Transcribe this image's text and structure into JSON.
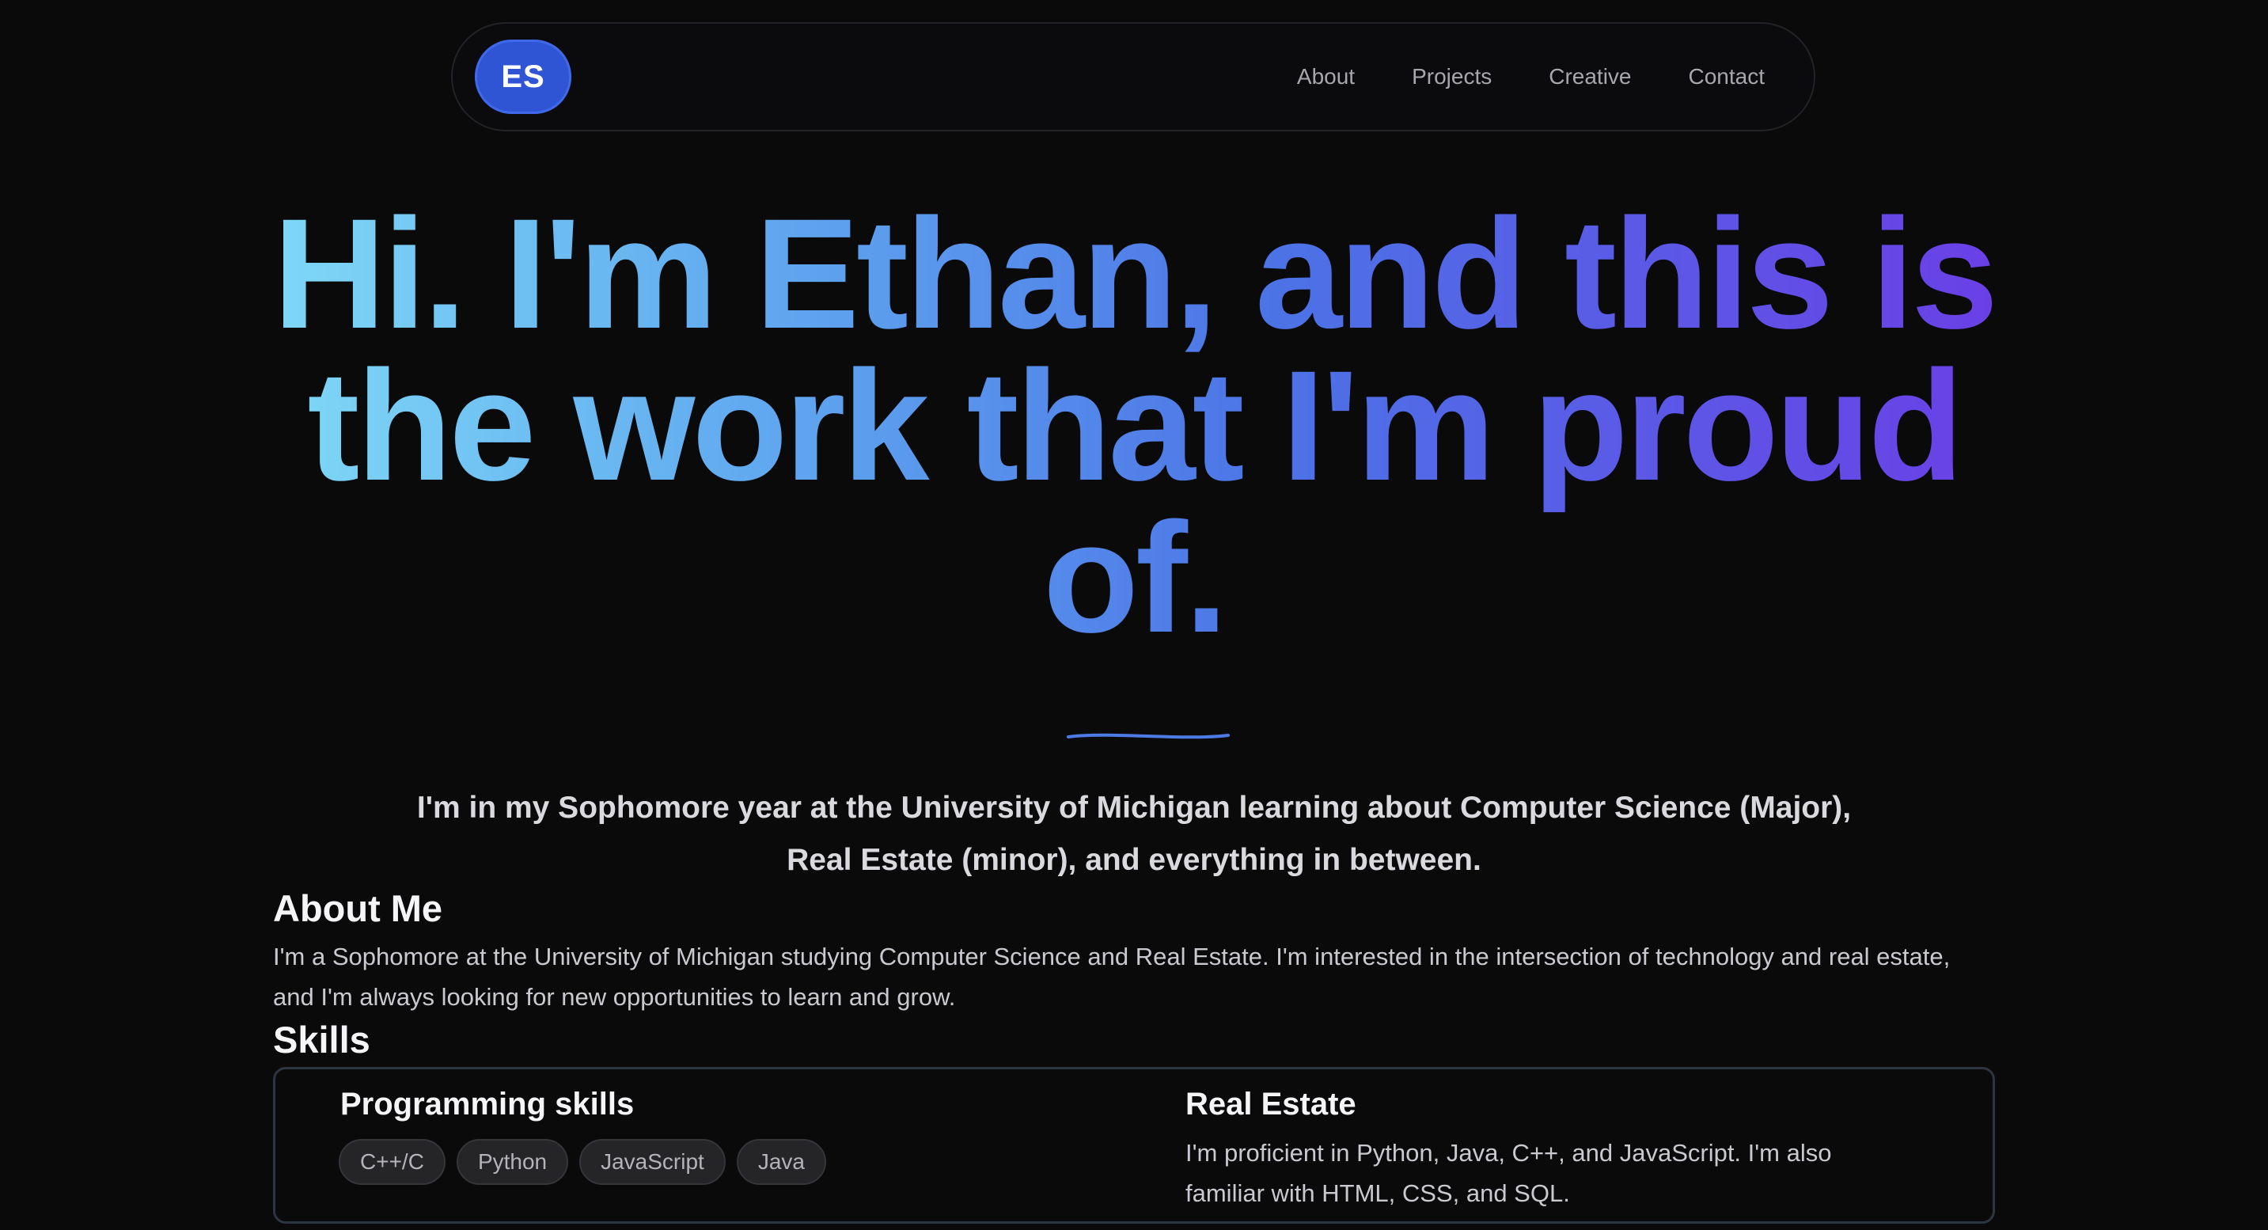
{
  "navbar": {
    "logo": "ES",
    "links": [
      "About",
      "Projects",
      "Creative",
      "Contact"
    ]
  },
  "hero": {
    "lines": [
      "Hi. I'm Ethan, and this is",
      "the work that I'm proud",
      "of."
    ],
    "gradient_colors": [
      "#7fd9f6",
      "#5fa6ef",
      "#4c73e6",
      "#6a3fe6"
    ]
  },
  "intro": {
    "line1": "I'm in my Sophomore year at the University of Michigan learning about Computer Science (Major),",
    "line2": "Real Estate (minor), and everything in between."
  },
  "about": {
    "heading": "About Me",
    "text": "I'm a Sophomore at the University of Michigan studying Computer Science and Real Estate. I'm interested in the intersection of technology and real estate, and I'm always looking for new opportunities to learn and grow."
  },
  "skills": {
    "heading": "Skills",
    "programming": {
      "title": "Programming skills",
      "tags": [
        "C++/C",
        "Python",
        "JavaScript",
        "Java"
      ]
    },
    "real_estate": {
      "title": "Real Estate",
      "text": "I'm proficient in Python, Java, C++, and JavaScript. I'm also familiar with HTML, CSS, and SQL."
    }
  },
  "colors": {
    "background": "#0a0a0b",
    "accent": "#2f55d4",
    "divider": "#4d7be6"
  }
}
